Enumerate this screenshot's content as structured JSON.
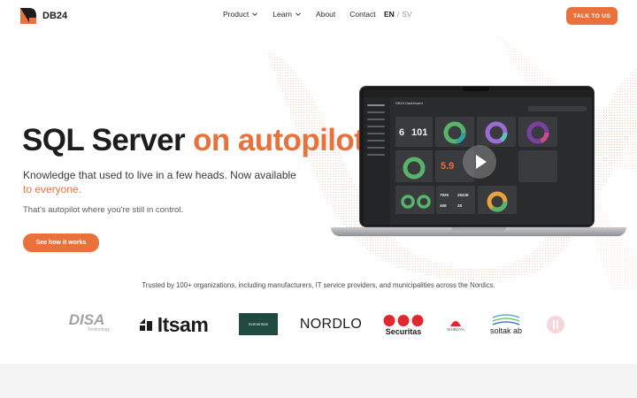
{
  "brand": {
    "name": "DB24",
    "accent": "#e8713c"
  },
  "nav": {
    "items": [
      {
        "label": "Product",
        "dropdown": true
      },
      {
        "label": "Learn",
        "dropdown": true
      },
      {
        "label": "About",
        "dropdown": false
      },
      {
        "label": "Contact",
        "dropdown": false
      }
    ],
    "lang_active": "EN",
    "lang_separator": "/",
    "lang_other": "SV",
    "cta": "TALK TO US"
  },
  "hero": {
    "headline_main": "SQL Server ",
    "headline_accent": "on autopilot_",
    "subtitle_main": "Knowledge that used to live in a few heads. Now available ",
    "subtitle_accent": "to everyone.",
    "subtitle_secondary": "That's autopilot where you're still in control.",
    "cta": "See how it works"
  },
  "dashboard": {
    "title": "DB24 Dashboard",
    "stat_left": "6",
    "stat_right": "101",
    "gauge_value": "5.9",
    "mini_a": "7926",
    "mini_b": "28438",
    "mini_c": "458",
    "mini_d": "28"
  },
  "trust": {
    "text": "Trusted by 100+ organizations, including manufacturers, IT service providers, and municipalities across the Nordics."
  },
  "logos": {
    "disa": "DISA",
    "disa_sub": "Technology",
    "itsam": "Itsam",
    "momentum": "momentum",
    "nordlo": "NORDLO",
    "securitas": "Securitas",
    "shibuya": "SHIBUYA",
    "soltak": "soltak ab"
  }
}
